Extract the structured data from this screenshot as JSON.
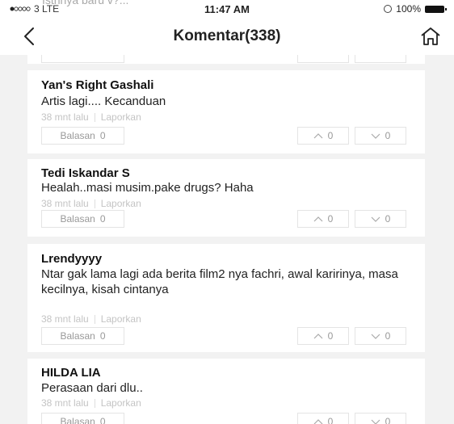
{
  "status_bar": {
    "ghost_text": "Istrinya baru v?...",
    "carrier": "3 LTE",
    "time": "11:47 AM",
    "battery": "100%"
  },
  "nav": {
    "title": "Komentar(338)",
    "back_icon": "chevron-left-icon",
    "home_icon": "home-icon"
  },
  "comments": [
    {
      "name": "Yan's Right Gashali",
      "text": "Artis lagi.... Kecanduan",
      "time": "38 mnt lalu",
      "report": "Laporkan",
      "reply_label": "Balasan",
      "reply_count": "0",
      "up_count": "0",
      "down_count": "0"
    },
    {
      "name": "Tedi Iskandar S",
      "text": "Healah..masi musim.pake drugs? Haha",
      "time": "38 mnt lalu",
      "report": "Laporkan",
      "reply_label": "Balasan",
      "reply_count": "0",
      "up_count": "0",
      "down_count": "0"
    },
    {
      "name": "Lrendyyyy",
      "text": "Ntar gak lama lagi ada berita film2 nya fachri, awal karirinya, masa kecilnya, kisah cintanya",
      "time": "38 mnt lalu",
      "report": "Laporkan",
      "reply_label": "Balasan",
      "reply_count": "0",
      "up_count": "0",
      "down_count": "0"
    },
    {
      "name": "HILDA LIA",
      "text": "Perasaan dari dlu..",
      "time": "38 mnt lalu",
      "report": "Laporkan",
      "reply_label": "Balasan",
      "reply_count": "0",
      "up_count": "0",
      "down_count": "0"
    }
  ]
}
